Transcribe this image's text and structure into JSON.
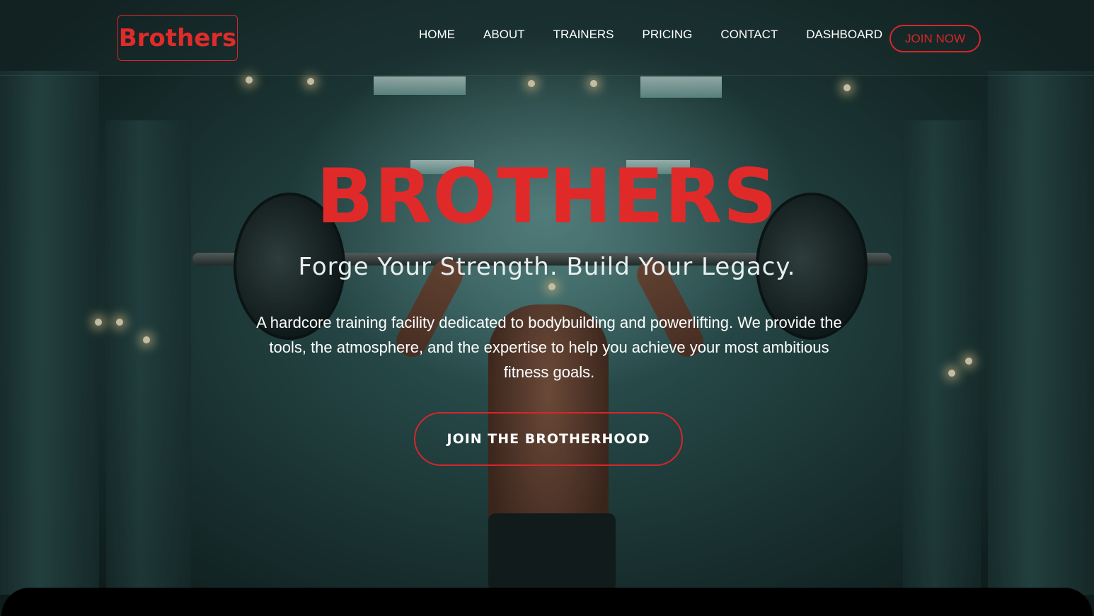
{
  "brand": {
    "logo_text": "Brothers",
    "accent_color": "#d7262a"
  },
  "nav": {
    "items": [
      {
        "label": "HOME"
      },
      {
        "label": "ABOUT"
      },
      {
        "label": "TRAINERS"
      },
      {
        "label": "PRICING"
      },
      {
        "label": "CONTACT"
      },
      {
        "label": "DASHBOARD"
      }
    ],
    "join_label": "JOIN NOW"
  },
  "hero": {
    "title": "BROTHERS",
    "subtitle": "Forge Your Strength. Build Your Legacy.",
    "description": "A hardcore training facility dedicated to bodybuilding and powerlifting. We provide the tools, the atmosphere, and the expertise to help you achieve your most ambitious fitness goals.",
    "cta_label": "JOIN THE BROTHERHOOD"
  }
}
